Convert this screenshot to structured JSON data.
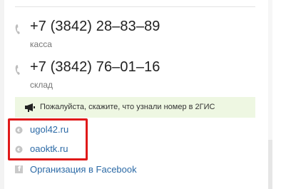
{
  "contacts": {
    "phones": [
      {
        "number": "+7 (3842) 28–83–89",
        "caption": "касса"
      },
      {
        "number": "+7 (3842) 76–01–16",
        "caption": "склад"
      }
    ],
    "notice": {
      "text": "Пожалуйста, скажите, что узнали номер в 2ГИС"
    },
    "links": [
      {
        "label": "ugol42.ru",
        "icon": "globe-icon"
      },
      {
        "label": "oaoktk.ru",
        "icon": "globe-icon"
      },
      {
        "label": "Организация в Facebook",
        "icon": "facebook-icon"
      }
    ]
  },
  "colors": {
    "link": "#2c6aa6",
    "notice_background": "#eef7e2",
    "highlight_border": "#e01919"
  }
}
